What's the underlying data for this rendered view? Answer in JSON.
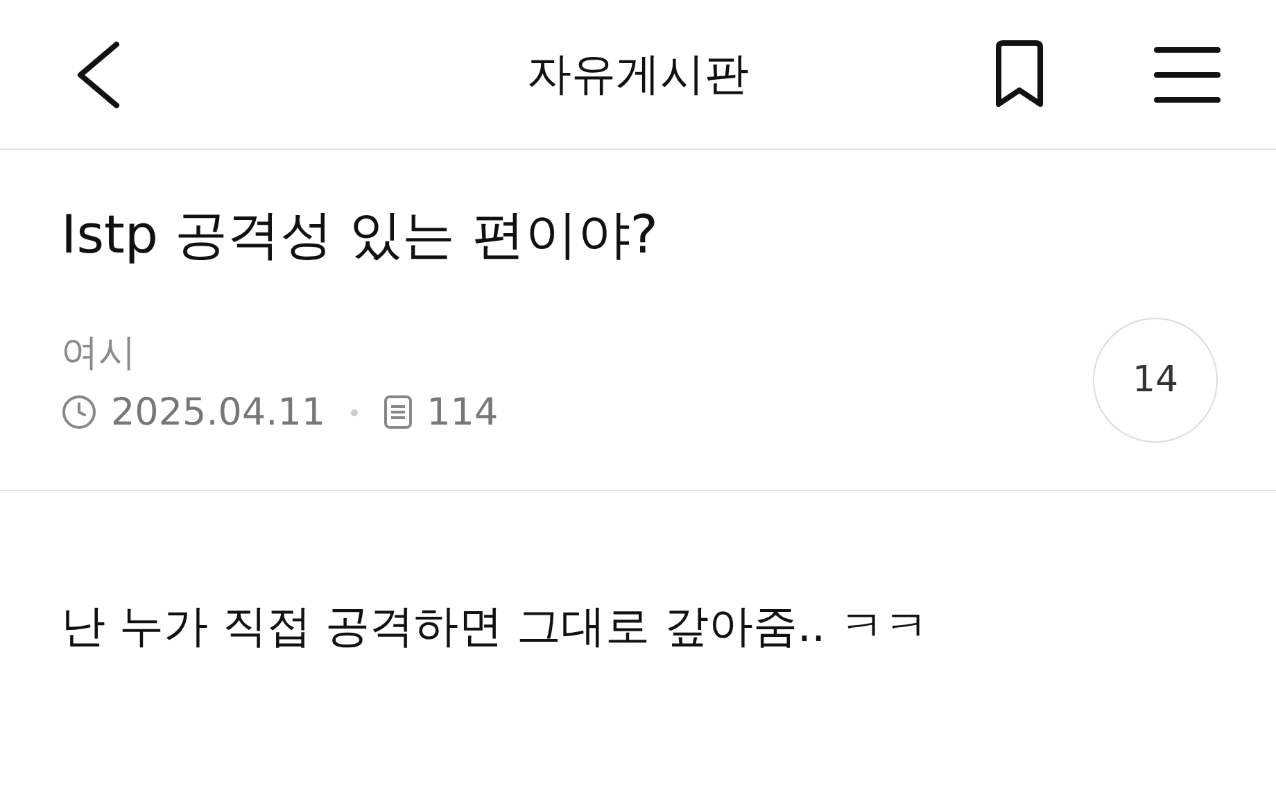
{
  "header": {
    "title": "자유게시판"
  },
  "post": {
    "title": "Istp 공격성 있는 편이야?",
    "author": "여시",
    "date": "2025.04.11",
    "views": "114",
    "comment_count": "14"
  },
  "body": "난 누가 직접 공격하면 그대로 갚아줌.. ㅋㅋ"
}
